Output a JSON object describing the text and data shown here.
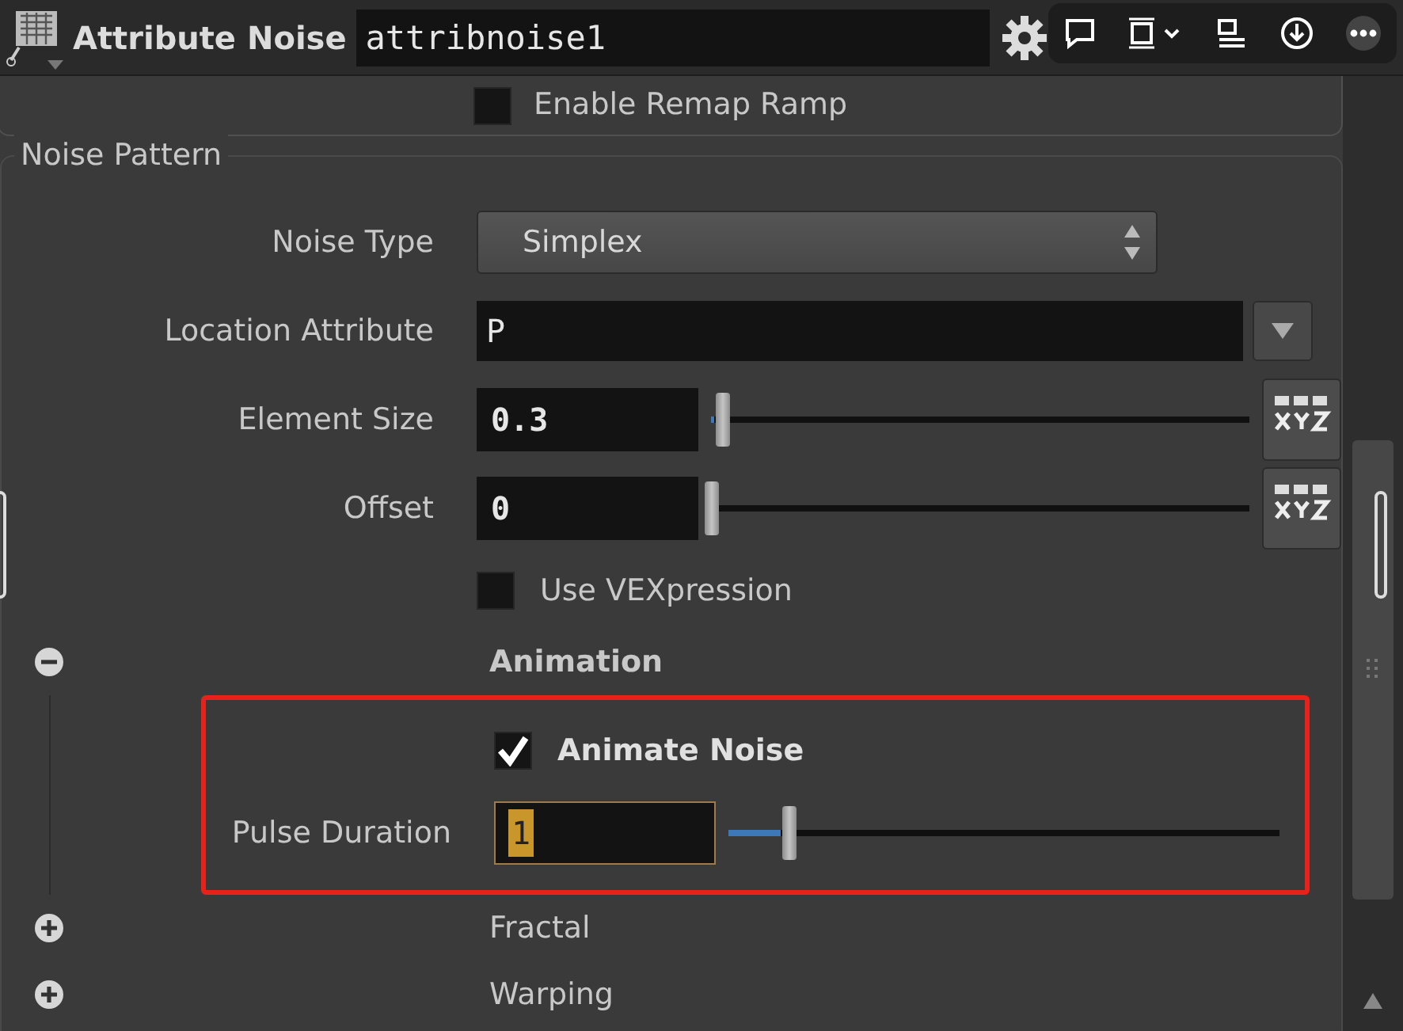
{
  "header": {
    "node_type": "Attribute Noise",
    "node_name": "attribnoise1"
  },
  "top_checkbox": {
    "label": "Enable Remap Ramp",
    "checked": false
  },
  "section": {
    "title": "Noise Pattern",
    "params": [
      {
        "kind": "menu",
        "label": "Noise Type",
        "value": "Simplex"
      },
      {
        "kind": "string",
        "label": "Location Attribute",
        "value": "P"
      },
      {
        "kind": "float",
        "label": "Element Size",
        "value": "0.3",
        "level": 0.02
      },
      {
        "kind": "float",
        "label": "Offset",
        "value": "0",
        "level": 0
      },
      {
        "kind": "toggle",
        "label": "Use VEXpression",
        "checked": false
      }
    ],
    "folders": [
      {
        "title": "Animation",
        "expanded": true,
        "highlighted": true,
        "params": [
          {
            "kind": "toggle",
            "label": "Animate Noise",
            "checked": true
          },
          {
            "kind": "float",
            "label": "Pulse Duration",
            "value": "1",
            "level": 0.11,
            "focused": true
          }
        ]
      },
      {
        "title": "Fractal",
        "expanded": false
      },
      {
        "title": "Warping",
        "expanded": false
      }
    ]
  }
}
